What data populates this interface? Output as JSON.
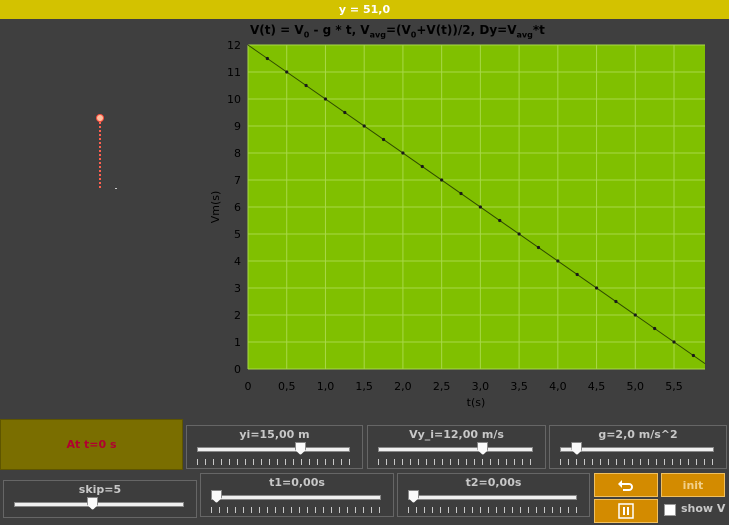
{
  "status_y": "y = 51,0",
  "formula": {
    "v_part": "V(t) = V",
    "zero1": "0",
    "v_rest": " - g * t,   V",
    "avg1": "avg",
    "eq": "=(V",
    "zero2": "0",
    "eq2": "+V(t))/2,   Dy=V",
    "avg2": "avg",
    "tail": "*t"
  },
  "status_box": "At t=0 s",
  "sliders": {
    "yi": {
      "label": "yi=15,00 m",
      "value": 0.69
    },
    "vyi": {
      "label": "Vy_i=12,00 m/s",
      "value": 0.69
    },
    "g": {
      "label": "g=2,0 m/s^2",
      "value": 0.08
    },
    "skip": {
      "label": "skip=5",
      "value": 0.46
    },
    "t1": {
      "label": "t1=0,00s",
      "value": 0.0
    },
    "t2": {
      "label": "t2=0,00s",
      "value": 0.0
    }
  },
  "buttons": {
    "init": "init",
    "reset_icon": "undo-icon",
    "pause_icon": "pause-icon"
  },
  "show_v_label": "show V",
  "colors": {
    "plot_bg": "#80c000",
    "status_bar": "#d3c200",
    "button": "#d38b00"
  },
  "chart_data": {
    "type": "line",
    "xlabel": "t(s)",
    "ylabel": "Vm(s)",
    "xlim": [
      0,
      5.9
    ],
    "ylim": [
      0,
      12
    ],
    "xticks": [
      "0",
      "0,5",
      "1,0",
      "1,5",
      "2,0",
      "2,5",
      "3,0",
      "3,5",
      "4,0",
      "4,5",
      "5,0",
      "5,5"
    ],
    "yticks": [
      "0",
      "1",
      "2",
      "3",
      "4",
      "5",
      "6",
      "7",
      "8",
      "9",
      "10",
      "11",
      "12"
    ],
    "grid": true,
    "line": {
      "x": [
        0,
        6
      ],
      "y": [
        12,
        0
      ]
    },
    "points": {
      "x": [
        0.25,
        0.5,
        0.75,
        1.0,
        1.25,
        1.5,
        1.75,
        2.0,
        2.25,
        2.5,
        2.75,
        3.0,
        3.25,
        3.5,
        3.75,
        4.0,
        4.25,
        4.5,
        4.75,
        5.0,
        5.25,
        5.5,
        5.75
      ],
      "y": [
        11.5,
        11.0,
        10.5,
        10.0,
        9.5,
        9.0,
        8.5,
        8.0,
        7.5,
        7.0,
        6.5,
        6.0,
        5.5,
        5.0,
        4.5,
        4.0,
        3.5,
        3.0,
        2.5,
        2.0,
        1.5,
        1.0,
        0.5
      ]
    }
  }
}
